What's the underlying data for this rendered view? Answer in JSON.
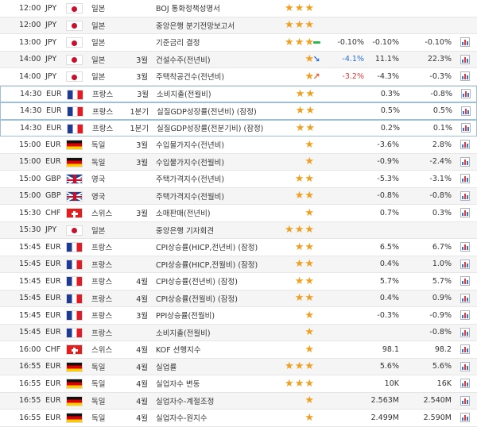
{
  "rows": [
    {
      "time": "12:00",
      "cur": "JPY",
      "flag": "jpy",
      "country": "일본",
      "period": "",
      "event": "BOJ 통화정책성명서",
      "stars": 3,
      "indicator": "",
      "actual": "",
      "actual_class": "",
      "forecast": "",
      "previous": "",
      "chart": false
    },
    {
      "time": "12:00",
      "cur": "JPY",
      "flag": "jpy",
      "country": "일본",
      "period": "",
      "event": "중앙은행 분기전망보고서",
      "stars": 3,
      "indicator": "",
      "actual": "",
      "actual_class": "",
      "forecast": "",
      "previous": "",
      "chart": false
    },
    {
      "time": "13:00",
      "cur": "JPY",
      "flag": "jpy",
      "country": "일본",
      "period": "",
      "event": "기준금리 결정",
      "stars": 3,
      "indicator": "flat",
      "actual": "-0.10%",
      "actual_class": "",
      "forecast": "-0.10%",
      "previous": "-0.10%",
      "chart": true
    },
    {
      "time": "14:00",
      "cur": "JPY",
      "flag": "jpy",
      "country": "일본",
      "period": "3월",
      "event": "건설수주(전년비)",
      "stars": 1,
      "indicator": "down",
      "actual": "-4.1%",
      "actual_class": "pos",
      "forecast": "11.1%",
      "previous": "22.3%",
      "chart": true
    },
    {
      "time": "14:00",
      "cur": "JPY",
      "flag": "jpy",
      "country": "일본",
      "period": "3월",
      "event": "주택착공건수(전년비)",
      "stars": 1,
      "indicator": "up",
      "actual": "-3.2%",
      "actual_class": "neg",
      "forecast": "-4.3%",
      "previous": "-0.3%",
      "chart": true
    },
    {
      "time": "14:30",
      "cur": "EUR",
      "flag": "eur",
      "country": "프랑스",
      "period": "3월",
      "event": "소비지출(전월비)",
      "stars": 2,
      "indicator": "",
      "actual": "",
      "actual_class": "",
      "forecast": "0.3%",
      "previous": "-0.8%",
      "chart": true,
      "hl": true
    },
    {
      "time": "14:30",
      "cur": "EUR",
      "flag": "eur",
      "country": "프랑스",
      "period": "1분기",
      "event": "실질GDP성장률(전년비) (잠정)",
      "stars": 2,
      "indicator": "",
      "actual": "",
      "actual_class": "",
      "forecast": "0.5%",
      "previous": "0.5%",
      "chart": true,
      "hl": true
    },
    {
      "time": "14:30",
      "cur": "EUR",
      "flag": "eur",
      "country": "프랑스",
      "period": "1분기",
      "event": "실질GDP성장률(전분기비) (잠정)",
      "stars": 2,
      "indicator": "",
      "actual": "",
      "actual_class": "",
      "forecast": "0.2%",
      "previous": "0.1%",
      "chart": true,
      "hl": true
    },
    {
      "time": "15:00",
      "cur": "EUR",
      "flag": "de",
      "country": "독일",
      "period": "3월",
      "event": "수입물가지수(전년비)",
      "stars": 1,
      "indicator": "",
      "actual": "",
      "actual_class": "",
      "forecast": "-3.6%",
      "previous": "2.8%",
      "chart": true
    },
    {
      "time": "15:00",
      "cur": "EUR",
      "flag": "de",
      "country": "독일",
      "period": "3월",
      "event": "수입물가지수(전월비)",
      "stars": 1,
      "indicator": "",
      "actual": "",
      "actual_class": "",
      "forecast": "-0.9%",
      "previous": "-2.4%",
      "chart": true
    },
    {
      "time": "15:00",
      "cur": "GBP",
      "flag": "gbp",
      "country": "영국",
      "period": "",
      "event": "주택가격지수(전년비)",
      "stars": 2,
      "indicator": "",
      "actual": "",
      "actual_class": "",
      "forecast": "-5.3%",
      "previous": "-3.1%",
      "chart": true
    },
    {
      "time": "15:00",
      "cur": "GBP",
      "flag": "gbp",
      "country": "영국",
      "period": "",
      "event": "주택가격지수(전월비)",
      "stars": 2,
      "indicator": "",
      "actual": "",
      "actual_class": "",
      "forecast": "-0.8%",
      "previous": "-0.8%",
      "chart": true
    },
    {
      "time": "15:30",
      "cur": "CHF",
      "flag": "chf",
      "country": "스위스",
      "period": "3월",
      "event": "소매판매(전년비)",
      "stars": 1,
      "indicator": "",
      "actual": "",
      "actual_class": "",
      "forecast": "0.7%",
      "previous": "0.3%",
      "chart": true
    },
    {
      "time": "15:30",
      "cur": "JPY",
      "flag": "jpy",
      "country": "일본",
      "period": "",
      "event": "중앙은행 기자회견",
      "stars": 3,
      "indicator": "",
      "actual": "",
      "actual_class": "",
      "forecast": "",
      "previous": "",
      "chart": false
    },
    {
      "time": "15:45",
      "cur": "EUR",
      "flag": "eur",
      "country": "프랑스",
      "period": "",
      "event": "CPI상승률(HICP,전년비) (잠정)",
      "stars": 2,
      "indicator": "",
      "actual": "",
      "actual_class": "",
      "forecast": "6.5%",
      "previous": "6.7%",
      "chart": true
    },
    {
      "time": "15:45",
      "cur": "EUR",
      "flag": "eur",
      "country": "프랑스",
      "period": "",
      "event": "CPI상승률(HICP,전월비) (잠정)",
      "stars": 2,
      "indicator": "",
      "actual": "",
      "actual_class": "",
      "forecast": "0.4%",
      "previous": "1.0%",
      "chart": true
    },
    {
      "time": "15:45",
      "cur": "EUR",
      "flag": "eur",
      "country": "프랑스",
      "period": "4월",
      "event": "CPI상승률(전년비) (잠정)",
      "stars": 2,
      "indicator": "",
      "actual": "",
      "actual_class": "",
      "forecast": "5.7%",
      "previous": "5.7%",
      "chart": true
    },
    {
      "time": "15:45",
      "cur": "EUR",
      "flag": "eur",
      "country": "프랑스",
      "period": "4월",
      "event": "CPI상승률(전월비) (잠정)",
      "stars": 2,
      "indicator": "",
      "actual": "",
      "actual_class": "",
      "forecast": "0.4%",
      "previous": "0.9%",
      "chart": true
    },
    {
      "time": "15:45",
      "cur": "EUR",
      "flag": "eur",
      "country": "프랑스",
      "period": "3월",
      "event": "PPI상승률(전월비)",
      "stars": 1,
      "indicator": "",
      "actual": "",
      "actual_class": "",
      "forecast": "-0.3%",
      "previous": "-0.9%",
      "chart": true
    },
    {
      "time": "15:45",
      "cur": "EUR",
      "flag": "eur",
      "country": "프랑스",
      "period": "",
      "event": "소비지출(전월비)",
      "stars": 1,
      "indicator": "",
      "actual": "",
      "actual_class": "",
      "forecast": "",
      "previous": "-0.8%",
      "chart": true
    },
    {
      "time": "16:00",
      "cur": "CHF",
      "flag": "chf",
      "country": "스위스",
      "period": "4월",
      "event": "KOF 선행지수",
      "stars": 1,
      "indicator": "",
      "actual": "",
      "actual_class": "",
      "forecast": "98.1",
      "previous": "98.2",
      "chart": true
    },
    {
      "time": "16:55",
      "cur": "EUR",
      "flag": "de",
      "country": "독일",
      "period": "4월",
      "event": "실업률",
      "stars": 3,
      "indicator": "",
      "actual": "",
      "actual_class": "",
      "forecast": "5.6%",
      "previous": "5.6%",
      "chart": true
    },
    {
      "time": "16:55",
      "cur": "EUR",
      "flag": "de",
      "country": "독일",
      "period": "4월",
      "event": "실업자수 변동",
      "stars": 3,
      "indicator": "",
      "actual": "",
      "actual_class": "",
      "forecast": "10K",
      "previous": "16K",
      "chart": true
    },
    {
      "time": "16:55",
      "cur": "EUR",
      "flag": "de",
      "country": "독일",
      "period": "4월",
      "event": "실업자수-계절조정",
      "stars": 1,
      "indicator": "",
      "actual": "",
      "actual_class": "",
      "forecast": "2.563M",
      "previous": "2.540M",
      "chart": true
    },
    {
      "time": "16:55",
      "cur": "EUR",
      "flag": "de",
      "country": "독일",
      "period": "4월",
      "event": "실업자수-원지수",
      "stars": 1,
      "indicator": "",
      "actual": "",
      "actual_class": "",
      "forecast": "2.499M",
      "previous": "2.590M",
      "chart": true
    }
  ]
}
